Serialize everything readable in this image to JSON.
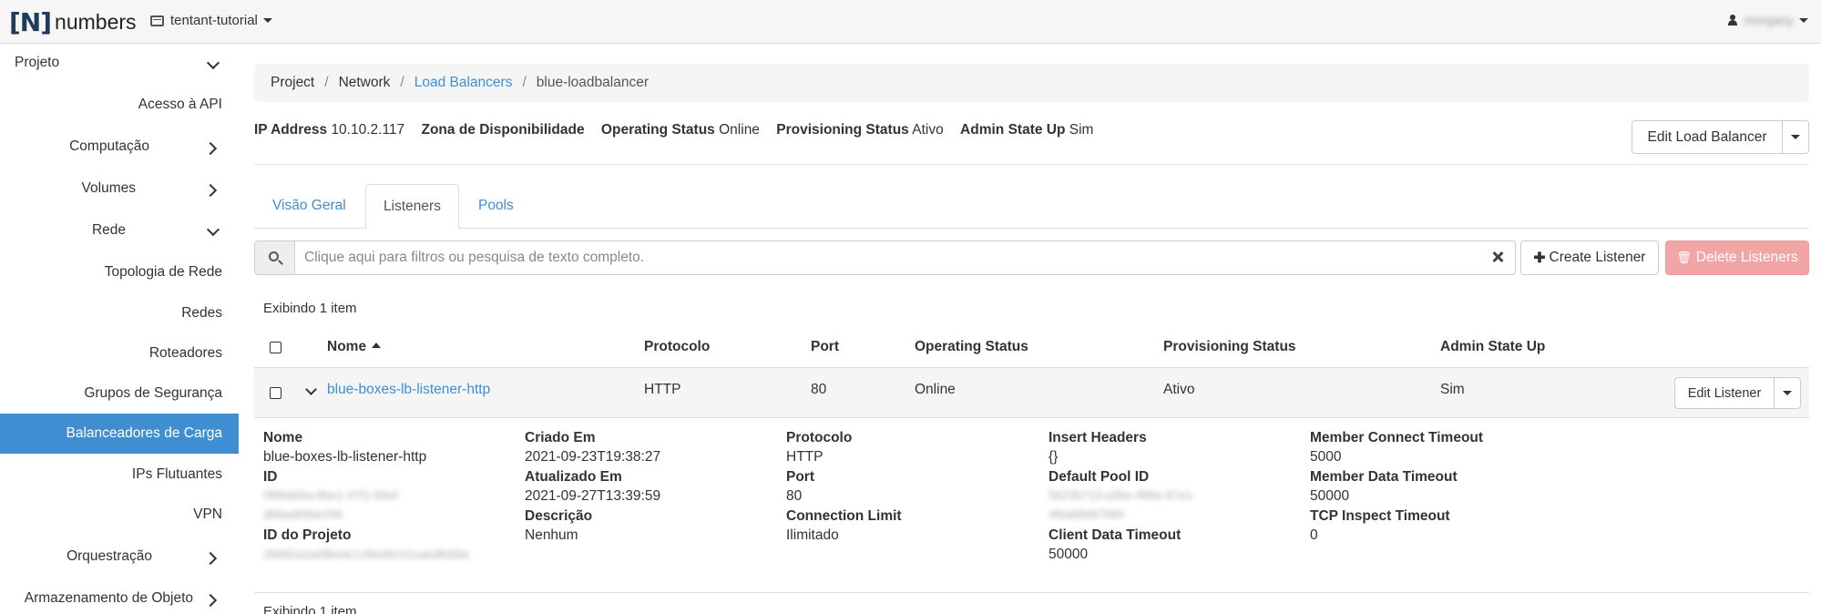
{
  "navbar": {
    "logo_bracket": "[N]",
    "logo_text": "numbers",
    "project": "tentant-tutorial",
    "user": "morgany"
  },
  "sidebar": {
    "items": [
      {
        "label": "Projeto",
        "expanded": true
      },
      {
        "label": "Acesso à API"
      },
      {
        "label": "Computação"
      },
      {
        "label": "Volumes"
      },
      {
        "label": "Rede",
        "expanded": true
      },
      {
        "label": "Topologia de Rede"
      },
      {
        "label": "Redes"
      },
      {
        "label": "Roteadores"
      },
      {
        "label": "Grupos de Segurança"
      },
      {
        "label": "Balanceadores de Carga",
        "active": true
      },
      {
        "label": "IPs Flutuantes"
      },
      {
        "label": "VPN"
      },
      {
        "label": "Orquestração"
      },
      {
        "label": "Armazenamento de Objeto"
      }
    ]
  },
  "breadcrumb": {
    "items": [
      "Project",
      "Network",
      "Load Balancers",
      "blue-loadbalancer"
    ],
    "separator": "/"
  },
  "summary": {
    "ip_label": "IP Address",
    "ip_value": "10.10.2.117",
    "zone_label": "Zona de Disponibilidade",
    "op_label": "Operating Status",
    "op_value": "Online",
    "prov_label": "Provisioning Status",
    "prov_value": "Ativo",
    "admin_label": "Admin State Up",
    "admin_value": "Sim"
  },
  "actions": {
    "edit_lb": "Edit Load Balancer",
    "create_listener": "Create Listener",
    "delete_listeners": "Delete Listeners",
    "edit_listener": "Edit Listener"
  },
  "tabs": [
    "Visão Geral",
    "Listeners",
    "Pools"
  ],
  "search": {
    "placeholder": "Clique aqui para filtros ou pesquisa de texto completo."
  },
  "table": {
    "count_text": "Exibindo 1 item",
    "headers": [
      "Nome",
      "Protocolo",
      "Port",
      "Operating Status",
      "Provisioning Status",
      "Admin State Up"
    ],
    "rows": [
      {
        "name": "blue-boxes-lb-listener-http",
        "protocol": "HTTP",
        "port": "80",
        "operating": "Online",
        "provisioning": "Ativo",
        "admin": "Sim"
      }
    ]
  },
  "detail": {
    "nome_label": "Nome",
    "nome_value": "blue-boxes-lb-listener-http",
    "id_label": "ID",
    "id_line1": "0f89dd3a-9be1-47f1-93af-",
    "id_line2": "db8ad69be208",
    "projid_label": "ID do Projeto",
    "projid_value": "2b882a2a08b44c139ed0c01cabdf0d9a",
    "criado_label": "Criado Em",
    "criado_value": "2021-09-23T19:38:27",
    "atual_label": "Atualizado Em",
    "atual_value": "2021-09-27T13:39:59",
    "desc_label": "Descrição",
    "desc_value": "Nenhum",
    "proto_label": "Protocolo",
    "proto_value": "HTTP",
    "port_label": "Port",
    "port_value": "80",
    "conn_label": "Connection Limit",
    "conn_value": "Ilimitado",
    "insert_label": "Insert Headers",
    "insert_value": "{}",
    "pool_label": "Default Pool ID",
    "pool_line1": "5623b713-a3be-489e-87e1-",
    "pool_line2": "4f6dd8d67584",
    "client_label": "Client Data Timeout",
    "client_value": "50000",
    "mct_label": "Member Connect Timeout",
    "mct_value": "5000",
    "mdt_label": "Member Data Timeout",
    "mdt_value": "50000",
    "tcp_label": "TCP Inspect Timeout",
    "tcp_value": "0"
  }
}
